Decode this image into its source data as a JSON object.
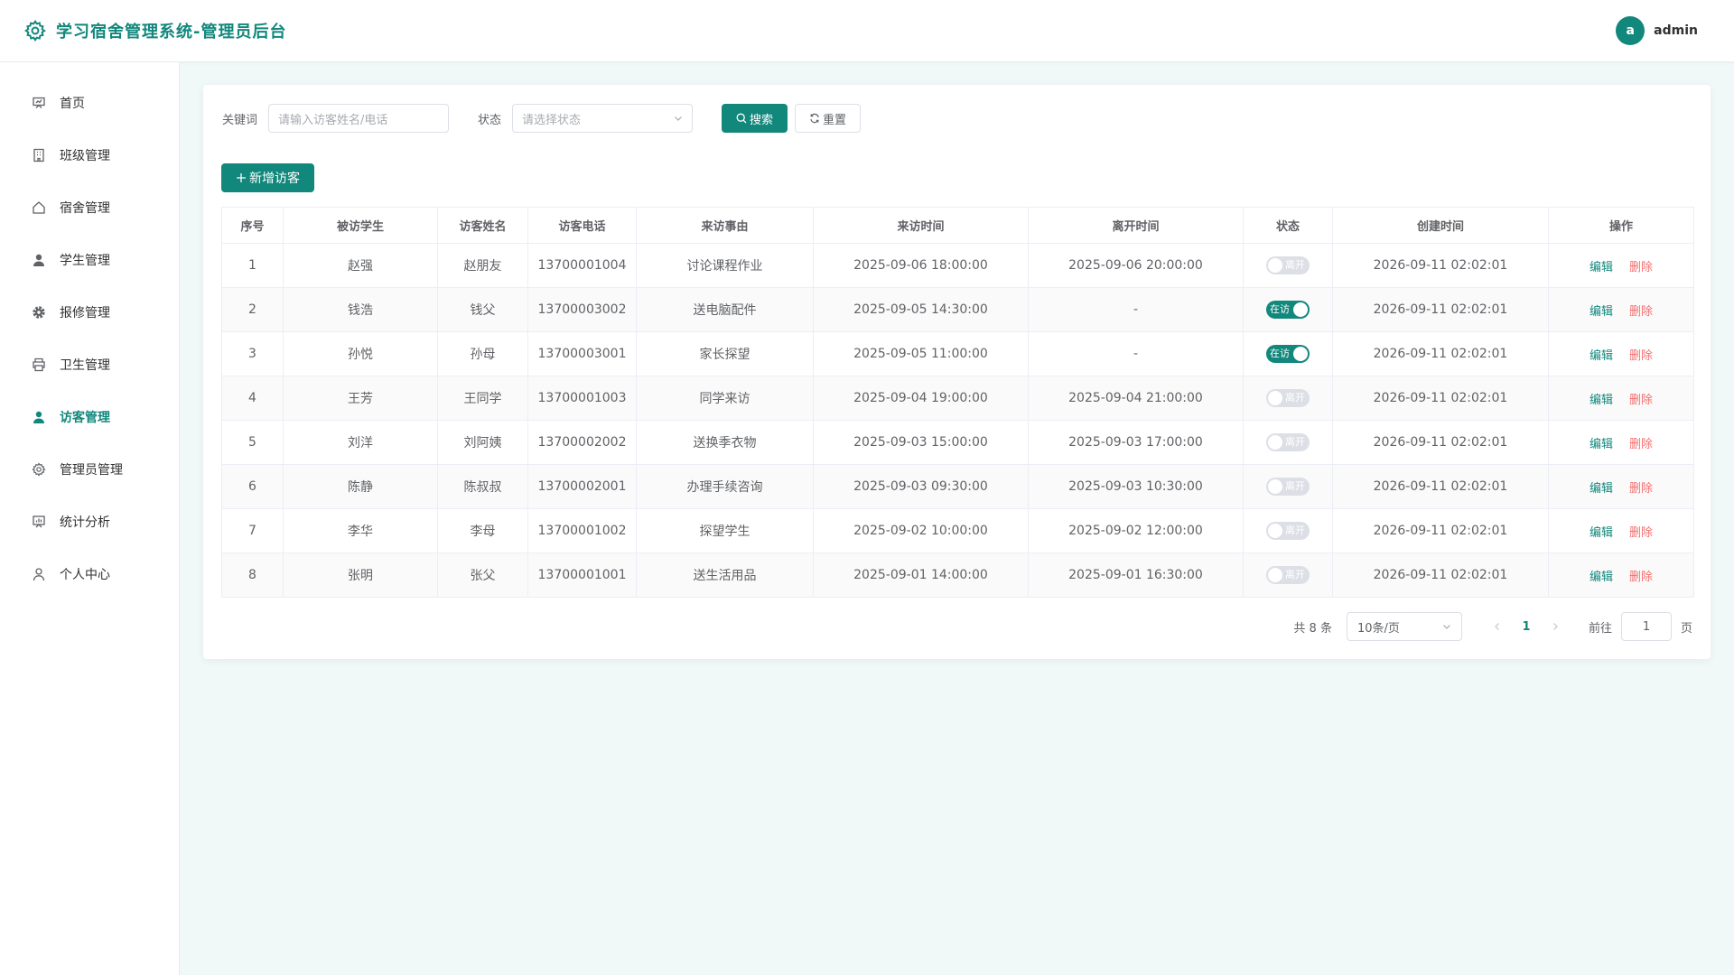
{
  "app": {
    "title": "学习宿舍管理系统-管理员后台",
    "brand_color": "#12877c"
  },
  "user": {
    "avatar_letter": "a",
    "name": "admin"
  },
  "sidebar": {
    "items": [
      {
        "label": "首页",
        "icon": "dashboard-icon"
      },
      {
        "label": "班级管理",
        "icon": "building-icon"
      },
      {
        "label": "宿舍管理",
        "icon": "house-icon"
      },
      {
        "label": "学生管理",
        "icon": "user-icon"
      },
      {
        "label": "报修管理",
        "icon": "gear-icon"
      },
      {
        "label": "卫生管理",
        "icon": "printer-icon"
      },
      {
        "label": "访客管理",
        "icon": "user-icon",
        "active": true
      },
      {
        "label": "管理员管理",
        "icon": "settings-icon"
      },
      {
        "label": "统计分析",
        "icon": "chart-board-icon"
      },
      {
        "label": "个人中心",
        "icon": "user-outline-icon"
      }
    ]
  },
  "filters": {
    "keyword_label": "关键词",
    "keyword_placeholder": "请输入访客姓名/电话",
    "status_label": "状态",
    "status_placeholder": "请选择状态",
    "search_label": "搜索",
    "reset_label": "重置"
  },
  "actions": {
    "add_label": "新增访客"
  },
  "table": {
    "columns": [
      "序号",
      "被访学生",
      "访客姓名",
      "访客电话",
      "来访事由",
      "来访时间",
      "离开时间",
      "状态",
      "创建时间",
      "操作"
    ],
    "edit_label": "编辑",
    "delete_label": "删除",
    "status_on_text": "在访",
    "status_off_text": "离开",
    "rows": [
      {
        "no": "1",
        "student": "赵强",
        "visitor": "赵朋友",
        "phone": "13700001004",
        "reason": "讨论课程作业",
        "visit_time": "2025-09-06 18:00:00",
        "leave_time": "2025-09-06 20:00:00",
        "status_on": false,
        "created": "2026-09-11 02:02:01"
      },
      {
        "no": "2",
        "student": "钱浩",
        "visitor": "钱父",
        "phone": "13700003002",
        "reason": "送电脑配件",
        "visit_time": "2025-09-05 14:30:00",
        "leave_time": "-",
        "status_on": true,
        "created": "2026-09-11 02:02:01"
      },
      {
        "no": "3",
        "student": "孙悦",
        "visitor": "孙母",
        "phone": "13700003001",
        "reason": "家长探望",
        "visit_time": "2025-09-05 11:00:00",
        "leave_time": "-",
        "status_on": true,
        "created": "2026-09-11 02:02:01"
      },
      {
        "no": "4",
        "student": "王芳",
        "visitor": "王同学",
        "phone": "13700001003",
        "reason": "同学来访",
        "visit_time": "2025-09-04 19:00:00",
        "leave_time": "2025-09-04 21:00:00",
        "status_on": false,
        "created": "2026-09-11 02:02:01"
      },
      {
        "no": "5",
        "student": "刘洋",
        "visitor": "刘阿姨",
        "phone": "13700002002",
        "reason": "送换季衣物",
        "visit_time": "2025-09-03 15:00:00",
        "leave_time": "2025-09-03 17:00:00",
        "status_on": false,
        "created": "2026-09-11 02:02:01"
      },
      {
        "no": "6",
        "student": "陈静",
        "visitor": "陈叔叔",
        "phone": "13700002001",
        "reason": "办理手续咨询",
        "visit_time": "2025-09-03 09:30:00",
        "leave_time": "2025-09-03 10:30:00",
        "status_on": false,
        "created": "2026-09-11 02:02:01"
      },
      {
        "no": "7",
        "student": "李华",
        "visitor": "李母",
        "phone": "13700001002",
        "reason": "探望学生",
        "visit_time": "2025-09-02 10:00:00",
        "leave_time": "2025-09-02 12:00:00",
        "status_on": false,
        "created": "2026-09-11 02:02:01"
      },
      {
        "no": "8",
        "student": "张明",
        "visitor": "张父",
        "phone": "13700001001",
        "reason": "送生活用品",
        "visit_time": "2025-09-01 14:00:00",
        "leave_time": "2025-09-01 16:30:00",
        "status_on": false,
        "created": "2026-09-11 02:02:01"
      }
    ]
  },
  "pagination": {
    "total_text": "共 8 条",
    "page_size": "10条/页",
    "current_page": "1",
    "goto_label": "前往",
    "goto_value": "1",
    "page_suffix": "页"
  }
}
